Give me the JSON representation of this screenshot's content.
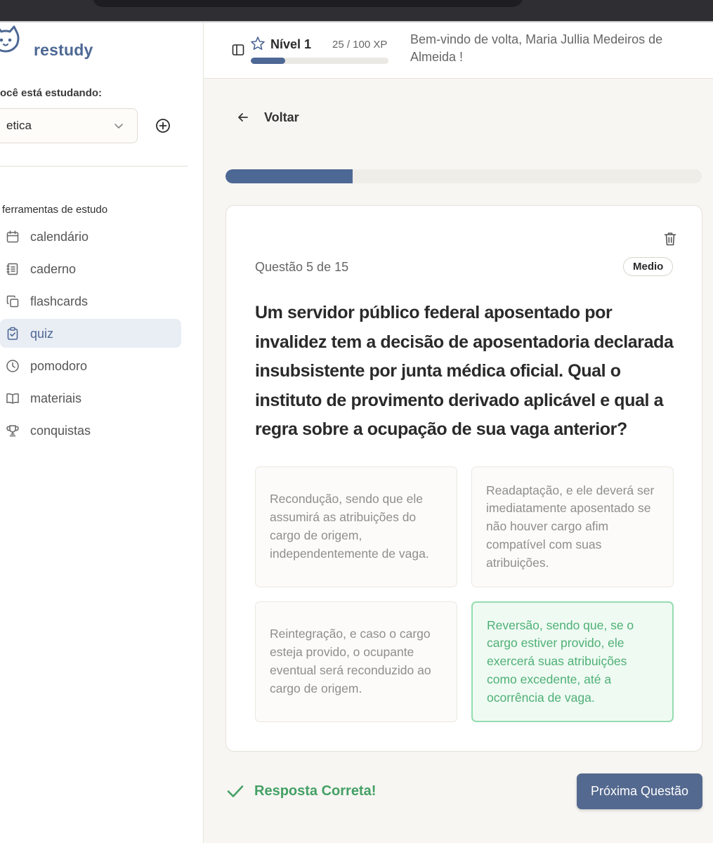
{
  "app": {
    "name": "restudy"
  },
  "sidebar": {
    "studying_label": "ocê está estudando:",
    "subject": "etica",
    "tools_label": "ferramentas de estudo",
    "items": [
      {
        "label": "calendário",
        "icon": "calendar-icon"
      },
      {
        "label": "caderno",
        "icon": "notebook-icon"
      },
      {
        "label": "flashcards",
        "icon": "copy-icon"
      },
      {
        "label": "quiz",
        "icon": "clipboard-check-icon",
        "active": true
      },
      {
        "label": "pomodoro",
        "icon": "clock-icon"
      },
      {
        "label": "materiais",
        "icon": "book-open-icon"
      },
      {
        "label": "conquistas",
        "icon": "trophy-icon"
      }
    ]
  },
  "header": {
    "level": "Nível 1",
    "xp": "25 / 100 XP",
    "xp_fraction": 0.25,
    "welcome": "Bem-vindo de volta, Maria Jullia Medeiros de Almeida !"
  },
  "quiz": {
    "back_label": "Voltar",
    "progress_fraction": 0.267,
    "question_count": "Questão 5 de 15",
    "difficulty": "Medio",
    "question": "Um servidor público federal aposentado por invalidez tem a decisão de aposentadoria declarada insubsistente por junta médica oficial. Qual o instituto de provimento derivado aplicável e qual a regra sobre a ocupação de sua vaga anterior?",
    "options": [
      "Recondução, sendo que ele assumirá as atribuições do cargo de origem, independentemente de vaga.",
      "Readaptação, e ele deverá ser imediatamente aposentado se não houver cargo afim compatível com suas atribuições.",
      "Reintegração, e caso o cargo esteja provido, o ocupante eventual será reconduzido ao cargo de origem.",
      "Reversão, sendo que, se o cargo estiver provido, ele exercerá suas atribuições como excedente, até a ocorrência de vaga."
    ],
    "correct_index": 3,
    "feedback": "Resposta Correta!",
    "next_label": "Próxima Questão"
  },
  "colors": {
    "accent": "#4d6894",
    "success": "#44a065",
    "success_bg": "#effaf3"
  }
}
